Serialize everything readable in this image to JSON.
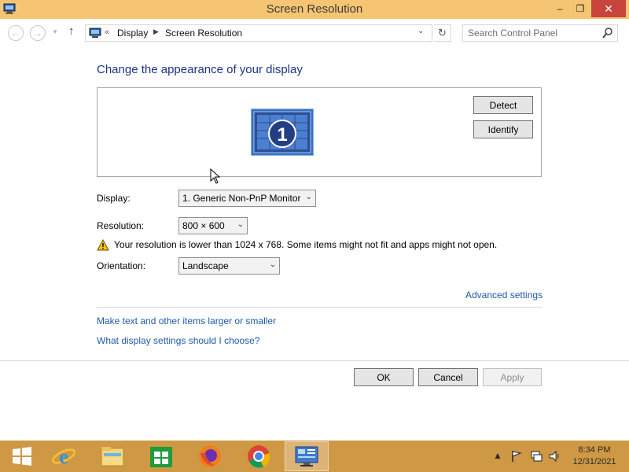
{
  "window": {
    "title": "Screen Resolution",
    "minimize_glyph": "‒",
    "maximize_glyph": "❐",
    "close_glyph": "✕"
  },
  "navigation": {
    "back_glyph": "←",
    "forward_glyph": "→",
    "up_glyph": "↑",
    "breadcrumb_prefix": "«",
    "breadcrumbs": [
      "Display",
      "Screen Resolution"
    ],
    "refresh_glyph": "↻",
    "search_placeholder": "Search Control Panel"
  },
  "main": {
    "heading": "Change the appearance of your display",
    "monitor_number": "1",
    "detect_label": "Detect",
    "identify_label": "Identify",
    "display_label": "Display:",
    "display_value": "1. Generic Non-PnP Monitor",
    "resolution_label": "Resolution:",
    "resolution_value": "800 × 600",
    "warning_text": "Your resolution is lower than 1024 x 768. Some items might not fit and apps might not open.",
    "orientation_label": "Orientation:",
    "orientation_value": "Landscape",
    "advanced_settings_link": "Advanced settings",
    "links": [
      "Make text and other items larger or smaller",
      "What display settings should I choose?"
    ]
  },
  "footer": {
    "ok_label": "OK",
    "cancel_label": "Cancel",
    "apply_label": "Apply"
  },
  "taskbar": {
    "items": [
      "start",
      "internet-explorer",
      "file-explorer",
      "store",
      "firefox",
      "chrome",
      "control-panel"
    ],
    "active_item": "control-panel",
    "tray_icons": [
      "show-hidden-icons",
      "action-center",
      "network",
      "volume"
    ],
    "time": "8:34 PM",
    "date": "12/31/2021"
  },
  "colors": {
    "title_bar": "#f6c574",
    "taskbar": "#cf9844",
    "heading": "#1e3287",
    "link": "#1f5ba7",
    "close_button": "#c7453c"
  }
}
